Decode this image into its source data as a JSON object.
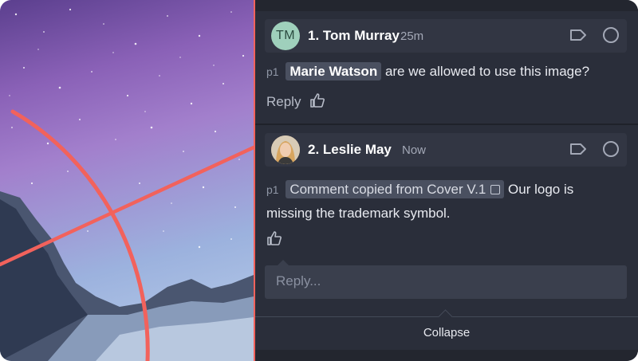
{
  "comments": [
    {
      "index_label": "1. Tom Murray",
      "avatar_initials": "TM",
      "time": "25m",
      "page_tag": "p1",
      "mention": "Marie Watson",
      "text": "are we allowed to use this image?",
      "reply_label": "Reply",
      "tag_icon": "tag-icon",
      "resolve_icon": "circle-icon"
    },
    {
      "index_label": "2. Leslie May",
      "time": "Now",
      "page_tag": "p1",
      "copied_label": "Comment copied from Cover V.1",
      "text_line1": "Our logo is",
      "text_line2": "missing the trademark symbol.",
      "tag_icon": "tag-icon",
      "resolve_icon": "circle-icon"
    }
  ],
  "reply_input": {
    "placeholder": "Reply..."
  },
  "collapse_label": "Collapse",
  "colors": {
    "accent": "#f2625c",
    "panel_bg": "#2a2e3a",
    "chip_bg": "#4a5060"
  }
}
